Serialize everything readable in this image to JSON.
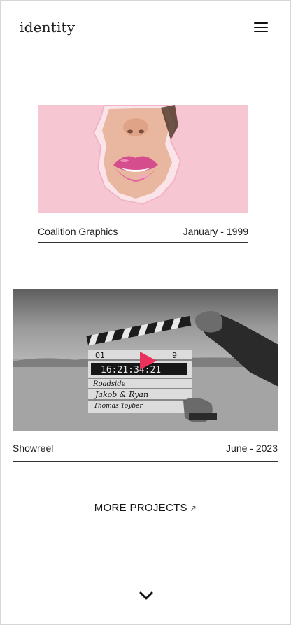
{
  "header": {
    "logo": "identity",
    "menu_icon": "hamburger-menu-icon"
  },
  "projects": [
    {
      "title": "Coalition Graphics",
      "date": "January - 1999",
      "thumbnail": "pink-lips-torn-paper"
    },
    {
      "title": "Showreel",
      "date": "June - 2023",
      "thumbnail": "clapperboard-desert",
      "play_icon": "play-icon"
    }
  ],
  "clapperboard": {
    "scene": "01",
    "take": "9",
    "timecode": "16:21:34:21",
    "production": "Roadside",
    "director": "Jakob & Ryan",
    "camera": "Thomas Toyber"
  },
  "more_link": {
    "label": "MORE PROJECTS",
    "arrow": "↗"
  },
  "scroll_icon": "chevron-down-icon",
  "colors": {
    "accent_play": "#e8315b",
    "pink_bg": "#f6c6d4",
    "rule": "#333333"
  }
}
